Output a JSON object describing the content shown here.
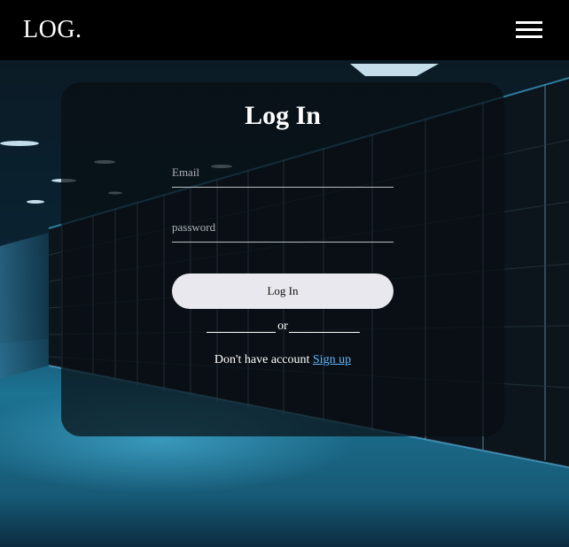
{
  "header": {
    "logo": "LOG.",
    "menu_icon": "hamburger-menu-icon"
  },
  "login": {
    "title": "Log In",
    "email_placeholder": "Email",
    "password_placeholder": "password",
    "button_label": "Log In",
    "divider_text": "or",
    "signup_prompt": "Don't have account",
    "signup_link": "Sign up"
  },
  "colors": {
    "header_bg": "#000000",
    "button_bg": "#e8e8ee",
    "link": "#5fb8ff"
  }
}
